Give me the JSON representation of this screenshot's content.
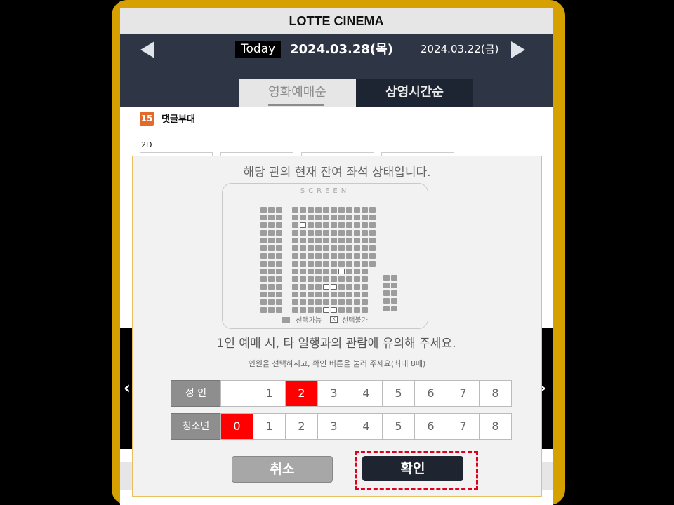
{
  "header": {
    "title": "LOTTE CINEMA"
  },
  "datebar": {
    "today_label": "Today",
    "current_date": "2024.03.28(목)",
    "next_date": "2024.03.22(금)"
  },
  "tabs": [
    {
      "label": "영화예매순"
    },
    {
      "label": "상영시간순"
    }
  ],
  "movie": {
    "rating": "15",
    "title": "댓글부대",
    "format": "2D"
  },
  "modal": {
    "heading": "해당 관의 현재 잔여 좌석 상태입니다.",
    "screen_label": "SCREEN",
    "legend_available": "선택가능",
    "legend_unavailable": "선택불가",
    "legend_x": "X",
    "notice": "1인 예매 시, 타 일행과의 관람에 유의해 주세요.",
    "instruction": "인원을 선택하시고, 확인 버튼을 눌러 주세요(최대 8매)",
    "adult": {
      "label": "성 인",
      "options": [
        "",
        "1",
        "2",
        "3",
        "4",
        "5",
        "6",
        "7",
        "8"
      ],
      "selected": "2"
    },
    "youth": {
      "label": "청소년",
      "options": [
        "0",
        "1",
        "2",
        "3",
        "4",
        "5",
        "6",
        "7",
        "8"
      ],
      "selected": "0"
    },
    "cancel_label": "취소",
    "confirm_label": "확인"
  },
  "colors": {
    "accent_selected": "#ff0000",
    "frame": "#d6a100",
    "navbar": "#2e3646",
    "highlight": "#e0001b"
  }
}
